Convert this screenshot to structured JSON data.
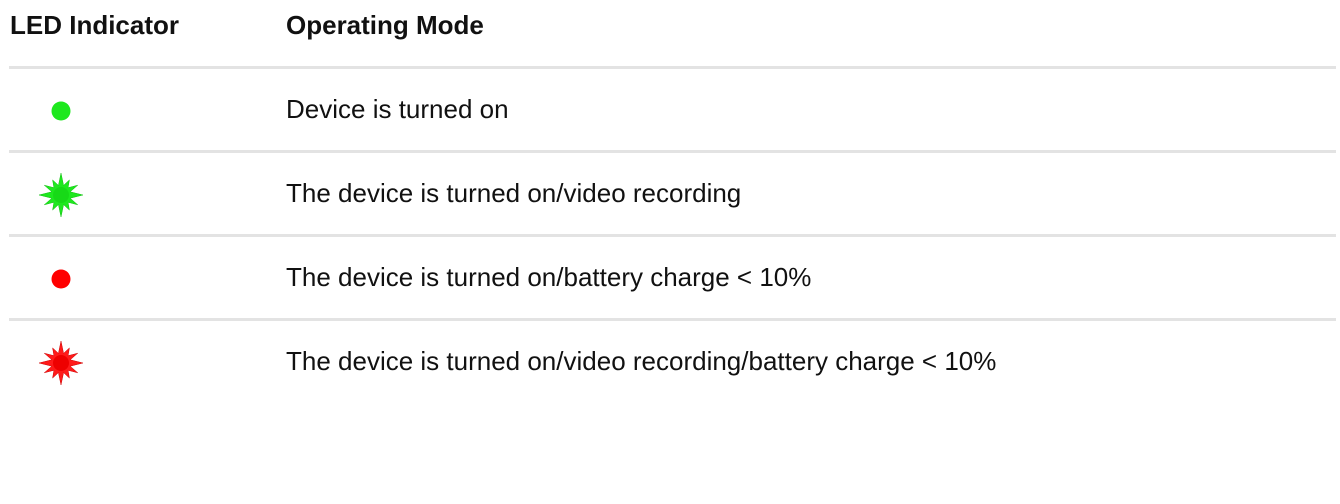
{
  "table": {
    "headers": {
      "led": "LED Indicator",
      "mode": "Operating Mode"
    },
    "rows": [
      {
        "icon": "green-dot-icon",
        "color": "#1ee81e",
        "blinking": false,
        "mode": "Device is turned on"
      },
      {
        "icon": "green-flashing-icon",
        "color": "#1ee81e",
        "blinking": true,
        "mode": "The device is turned on/video recording"
      },
      {
        "icon": "red-dot-icon",
        "color": "#ff0000",
        "blinking": false,
        "mode": "The device is turned on/battery charge < 10%"
      },
      {
        "icon": "red-flashing-icon",
        "color": "#ff0000",
        "blinking": true,
        "mode": "The device is turned on/video recording/battery charge < 10%"
      }
    ]
  }
}
